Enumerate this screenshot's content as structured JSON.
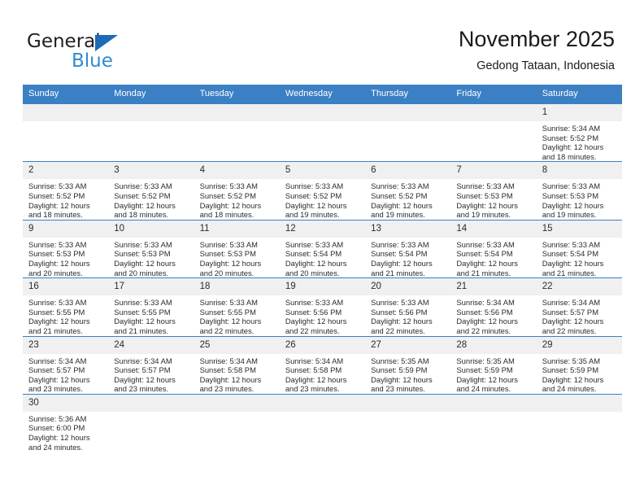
{
  "brand": {
    "name_top": "General",
    "name_bottom": "Blue",
    "flag_color": "#1b6cb3",
    "blue_text_color": "#2e8bd0"
  },
  "header": {
    "title": "November 2025",
    "subtitle": "Gedong Tataan, Indonesia"
  },
  "theme": {
    "header_row_bg": "#3b7fc4",
    "daynum_bg": "#f0f0f0",
    "grid_line": "#3b7fc4"
  },
  "weekdays": [
    "Sunday",
    "Monday",
    "Tuesday",
    "Wednesday",
    "Thursday",
    "Friday",
    "Saturday"
  ],
  "weeks": [
    [
      {
        "day": "",
        "lines": []
      },
      {
        "day": "",
        "lines": []
      },
      {
        "day": "",
        "lines": []
      },
      {
        "day": "",
        "lines": []
      },
      {
        "day": "",
        "lines": []
      },
      {
        "day": "",
        "lines": []
      },
      {
        "day": "1",
        "lines": [
          "Sunrise: 5:34 AM",
          "Sunset: 5:52 PM",
          "Daylight: 12 hours",
          "and 18 minutes."
        ]
      }
    ],
    [
      {
        "day": "2",
        "lines": [
          "Sunrise: 5:33 AM",
          "Sunset: 5:52 PM",
          "Daylight: 12 hours",
          "and 18 minutes."
        ]
      },
      {
        "day": "3",
        "lines": [
          "Sunrise: 5:33 AM",
          "Sunset: 5:52 PM",
          "Daylight: 12 hours",
          "and 18 minutes."
        ]
      },
      {
        "day": "4",
        "lines": [
          "Sunrise: 5:33 AM",
          "Sunset: 5:52 PM",
          "Daylight: 12 hours",
          "and 18 minutes."
        ]
      },
      {
        "day": "5",
        "lines": [
          "Sunrise: 5:33 AM",
          "Sunset: 5:52 PM",
          "Daylight: 12 hours",
          "and 19 minutes."
        ]
      },
      {
        "day": "6",
        "lines": [
          "Sunrise: 5:33 AM",
          "Sunset: 5:52 PM",
          "Daylight: 12 hours",
          "and 19 minutes."
        ]
      },
      {
        "day": "7",
        "lines": [
          "Sunrise: 5:33 AM",
          "Sunset: 5:53 PM",
          "Daylight: 12 hours",
          "and 19 minutes."
        ]
      },
      {
        "day": "8",
        "lines": [
          "Sunrise: 5:33 AM",
          "Sunset: 5:53 PM",
          "Daylight: 12 hours",
          "and 19 minutes."
        ]
      }
    ],
    [
      {
        "day": "9",
        "lines": [
          "Sunrise: 5:33 AM",
          "Sunset: 5:53 PM",
          "Daylight: 12 hours",
          "and 20 minutes."
        ]
      },
      {
        "day": "10",
        "lines": [
          "Sunrise: 5:33 AM",
          "Sunset: 5:53 PM",
          "Daylight: 12 hours",
          "and 20 minutes."
        ]
      },
      {
        "day": "11",
        "lines": [
          "Sunrise: 5:33 AM",
          "Sunset: 5:53 PM",
          "Daylight: 12 hours",
          "and 20 minutes."
        ]
      },
      {
        "day": "12",
        "lines": [
          "Sunrise: 5:33 AM",
          "Sunset: 5:54 PM",
          "Daylight: 12 hours",
          "and 20 minutes."
        ]
      },
      {
        "day": "13",
        "lines": [
          "Sunrise: 5:33 AM",
          "Sunset: 5:54 PM",
          "Daylight: 12 hours",
          "and 21 minutes."
        ]
      },
      {
        "day": "14",
        "lines": [
          "Sunrise: 5:33 AM",
          "Sunset: 5:54 PM",
          "Daylight: 12 hours",
          "and 21 minutes."
        ]
      },
      {
        "day": "15",
        "lines": [
          "Sunrise: 5:33 AM",
          "Sunset: 5:54 PM",
          "Daylight: 12 hours",
          "and 21 minutes."
        ]
      }
    ],
    [
      {
        "day": "16",
        "lines": [
          "Sunrise: 5:33 AM",
          "Sunset: 5:55 PM",
          "Daylight: 12 hours",
          "and 21 minutes."
        ]
      },
      {
        "day": "17",
        "lines": [
          "Sunrise: 5:33 AM",
          "Sunset: 5:55 PM",
          "Daylight: 12 hours",
          "and 21 minutes."
        ]
      },
      {
        "day": "18",
        "lines": [
          "Sunrise: 5:33 AM",
          "Sunset: 5:55 PM",
          "Daylight: 12 hours",
          "and 22 minutes."
        ]
      },
      {
        "day": "19",
        "lines": [
          "Sunrise: 5:33 AM",
          "Sunset: 5:56 PM",
          "Daylight: 12 hours",
          "and 22 minutes."
        ]
      },
      {
        "day": "20",
        "lines": [
          "Sunrise: 5:33 AM",
          "Sunset: 5:56 PM",
          "Daylight: 12 hours",
          "and 22 minutes."
        ]
      },
      {
        "day": "21",
        "lines": [
          "Sunrise: 5:34 AM",
          "Sunset: 5:56 PM",
          "Daylight: 12 hours",
          "and 22 minutes."
        ]
      },
      {
        "day": "22",
        "lines": [
          "Sunrise: 5:34 AM",
          "Sunset: 5:57 PM",
          "Daylight: 12 hours",
          "and 22 minutes."
        ]
      }
    ],
    [
      {
        "day": "23",
        "lines": [
          "Sunrise: 5:34 AM",
          "Sunset: 5:57 PM",
          "Daylight: 12 hours",
          "and 23 minutes."
        ]
      },
      {
        "day": "24",
        "lines": [
          "Sunrise: 5:34 AM",
          "Sunset: 5:57 PM",
          "Daylight: 12 hours",
          "and 23 minutes."
        ]
      },
      {
        "day": "25",
        "lines": [
          "Sunrise: 5:34 AM",
          "Sunset: 5:58 PM",
          "Daylight: 12 hours",
          "and 23 minutes."
        ]
      },
      {
        "day": "26",
        "lines": [
          "Sunrise: 5:34 AM",
          "Sunset: 5:58 PM",
          "Daylight: 12 hours",
          "and 23 minutes."
        ]
      },
      {
        "day": "27",
        "lines": [
          "Sunrise: 5:35 AM",
          "Sunset: 5:59 PM",
          "Daylight: 12 hours",
          "and 23 minutes."
        ]
      },
      {
        "day": "28",
        "lines": [
          "Sunrise: 5:35 AM",
          "Sunset: 5:59 PM",
          "Daylight: 12 hours",
          "and 24 minutes."
        ]
      },
      {
        "day": "29",
        "lines": [
          "Sunrise: 5:35 AM",
          "Sunset: 5:59 PM",
          "Daylight: 12 hours",
          "and 24 minutes."
        ]
      }
    ],
    [
      {
        "day": "30",
        "lines": [
          "Sunrise: 5:36 AM",
          "Sunset: 6:00 PM",
          "Daylight: 12 hours",
          "and 24 minutes."
        ]
      },
      {
        "day": "",
        "lines": []
      },
      {
        "day": "",
        "lines": []
      },
      {
        "day": "",
        "lines": []
      },
      {
        "day": "",
        "lines": []
      },
      {
        "day": "",
        "lines": []
      },
      {
        "day": "",
        "lines": []
      }
    ]
  ]
}
